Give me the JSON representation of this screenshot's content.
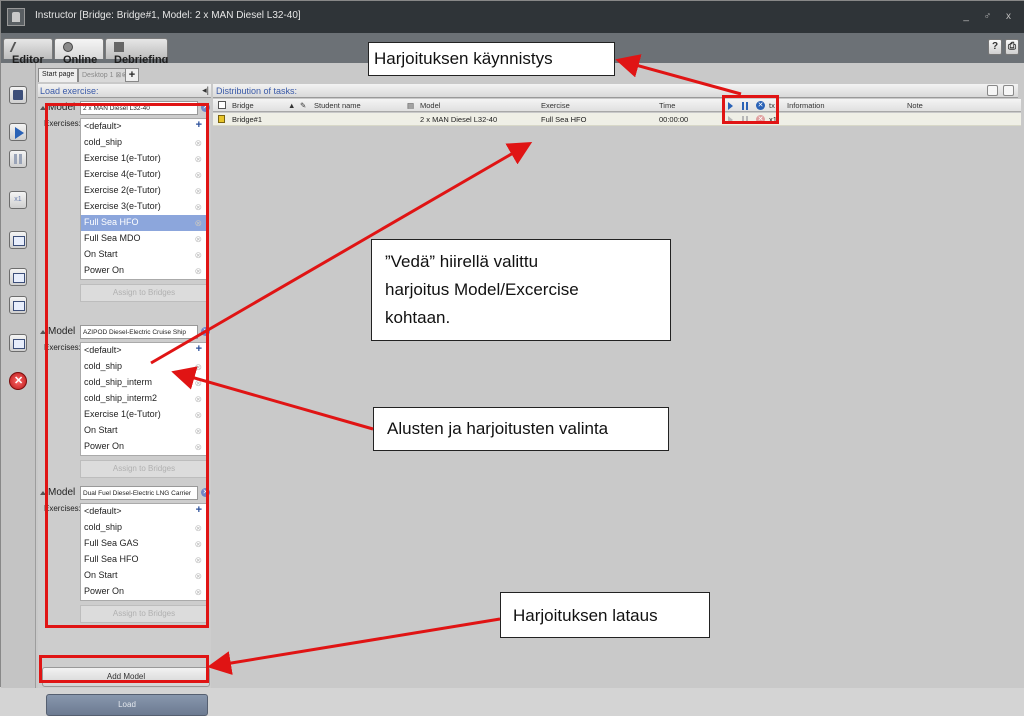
{
  "window": {
    "title": "Instructor [Bridge: Bridge#1, Model: 2 x MAN Diesel L32-40]",
    "controls": "_ ♂ x"
  },
  "main_tabs": [
    {
      "label": "Editor",
      "active": false
    },
    {
      "label": "Online",
      "active": true
    },
    {
      "label": "Debriefing",
      "active": false
    }
  ],
  "top_right": {
    "help_label": "?",
    "print_label": "⎙"
  },
  "sub_tabs": {
    "start": "Start page",
    "desktop": "Desktop 1"
  },
  "load_panel": {
    "header": "Load exercise:",
    "model_label": "Model",
    "exercises_label": "Exercises:",
    "assign_label": "Assign to Bridges",
    "add_model_label": "Add Model",
    "load_label": "Load",
    "models": [
      {
        "name": "2 x MAN Diesel L32-40",
        "exercises": [
          "<default>",
          "cold_ship",
          "Exercise 1(e-Tutor)",
          "Exercise 4(e-Tutor)",
          "Exercise 2(e-Tutor)",
          "Exercise 3(e-Tutor)",
          "Full Sea HFO",
          "Full Sea MDO",
          "On Start",
          "Power On"
        ],
        "selected_index": 6
      },
      {
        "name": "AZIPOD Diesel-Electric Cruise Ship",
        "exercises": [
          "<default>",
          "cold_ship",
          "cold_ship_interm",
          "cold_ship_interm2",
          "Exercise 1(e-Tutor)",
          "On Start",
          "Power On"
        ],
        "selected_index": -1
      },
      {
        "name": "Dual Fuel Diesel-Electric LNG Carrier",
        "exercises": [
          "<default>",
          "cold_ship",
          "Full Sea GAS",
          "Full Sea HFO",
          "On Start",
          "Power On"
        ],
        "selected_index": -1
      }
    ]
  },
  "distribution": {
    "header": "Distribution of tasks:",
    "columns": {
      "bridge": "Bridge",
      "student": "Student name",
      "model": "Model",
      "exercise": "Exercise",
      "time": "Time",
      "tx": "tx",
      "information": "Information",
      "note": "Note"
    },
    "rows": [
      {
        "bridge": "Bridge#1",
        "student": "",
        "model": "2 x MAN Diesel L32-40",
        "exercise": "Full Sea HFO",
        "time": "00:00:00",
        "tx": "x1",
        "information": "",
        "note": ""
      }
    ]
  },
  "annotations": {
    "start": "Harjoituksen käynnistys",
    "drag_line1": "”Vedä” hiirellä valittu",
    "drag_line2": "harjoitus Model/Excercise",
    "drag_line3": "kohtaan.",
    "select": "Alusten ja harjoitusten valinta",
    "load": "Harjoituksen lataus"
  },
  "colors": {
    "annotation_red": "#e01414",
    "selection_blue": "#8ca6dc",
    "accent_blue": "#2a62b6"
  }
}
